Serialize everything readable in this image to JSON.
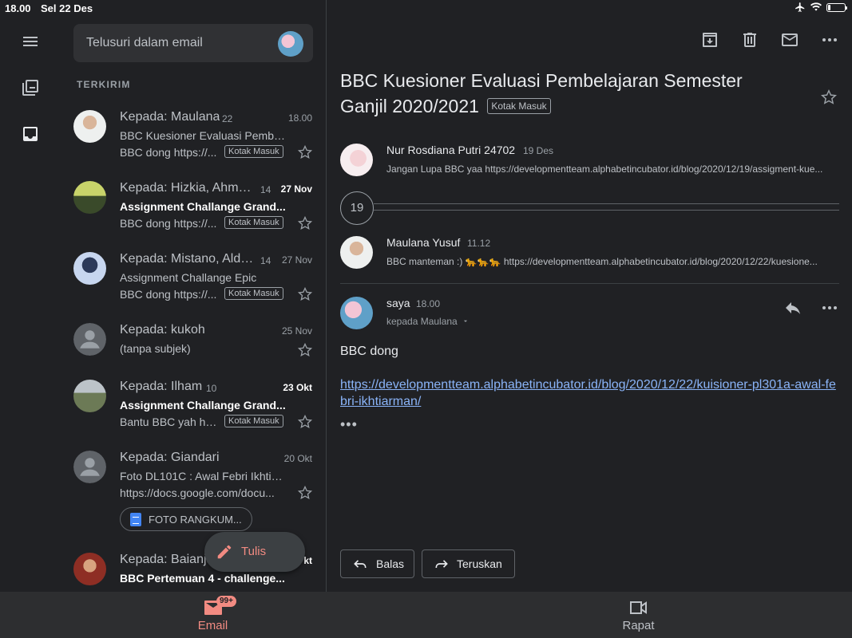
{
  "status_bar": {
    "time": "18.00",
    "date": "Sel 22 Des"
  },
  "colors": {
    "accent": "#f28b82",
    "link": "#8ab4f8",
    "background": "#202124"
  },
  "search": {
    "placeholder": "Telusuri dalam email"
  },
  "list": {
    "section_title": "TERKIRIM",
    "emails": [
      {
        "from": "Kepada: Maulana",
        "count": "22",
        "date": "18.00",
        "subject": "BBC Kuesioner Evaluasi Pembel...",
        "snippet": "BBC dong https://...",
        "label": "Kotak Masuk",
        "unread": false
      },
      {
        "from": "Kepada: Hizkia, Ahma...",
        "count": "14",
        "date": "27 Nov",
        "subject": "Assignment Challange Grand...",
        "snippet": "BBC dong https://...",
        "label": "Kotak Masuk",
        "unread": true
      },
      {
        "from": "Kepada: Mistano, Aldh...",
        "count": "14",
        "date": "27 Nov",
        "subject": "Assignment Challange Epic",
        "snippet": "BBC dong https://...",
        "label": "Kotak Masuk",
        "unread": false
      },
      {
        "from": "Kepada: kukoh",
        "count": "",
        "date": "25 Nov",
        "subject": "(tanpa subjek)",
        "snippet": "",
        "label": "",
        "unread": false
      },
      {
        "from": "Kepada: Ilham",
        "count": "10",
        "date": "23 Okt",
        "subject": "Assignment Challange Grand...",
        "snippet": "Bantu BBC yah htt...",
        "label": "Kotak Masuk",
        "unread": true
      },
      {
        "from": "Kepada: Giandari",
        "count": "",
        "date": "20 Okt",
        "subject": "Foto DL101C : Awal Febri Ikhtiar...",
        "snippet": "https://docs.google.com/docu...",
        "label": "",
        "unread": false,
        "attachment": "FOTO RANGKUM..."
      },
      {
        "from": "Kepada: Baianja",
        "count": "",
        "date": "kt",
        "subject": "BBC Pertemuan 4 - challenge...",
        "snippet": "",
        "label": "",
        "unread": true
      }
    ]
  },
  "fab": {
    "label": "Tulis"
  },
  "detail": {
    "title": "BBC Kuesioner Evaluasi Pembelajaran Semester Ganjil 2020/2021",
    "title_label": "Kotak Masuk",
    "messages": [
      {
        "sender": "Nur Rosdiana Putri 24702",
        "time": "19 Des",
        "preview": "Jangan Lupa BBC yaa https://developmentteam.alphabetincubator.id/blog/2020/12/19/assigment-kue..."
      },
      {
        "sender": "Maulana Yusuf",
        "time": "11.12",
        "preview": "BBC manteman :) 🐆🐆🐆 https://developmentteam.alphabetincubator.id/blog/2020/12/22/kuesione..."
      }
    ],
    "collapsed_count": "19",
    "opened": {
      "sender": "saya",
      "time": "18.00",
      "to": "kepada Maulana",
      "body": "BBC dong",
      "link": "https://developmentteam.alphabetincubator.id/blog/2020/12/22/kuisioner-pl301a-awal-febri-ikhtiarman/",
      "more": "•••"
    },
    "reply_label": "Balas",
    "forward_label": "Teruskan"
  },
  "bottom_nav": {
    "email_label": "Email",
    "email_badge": "99+",
    "meet_label": "Rapat"
  }
}
